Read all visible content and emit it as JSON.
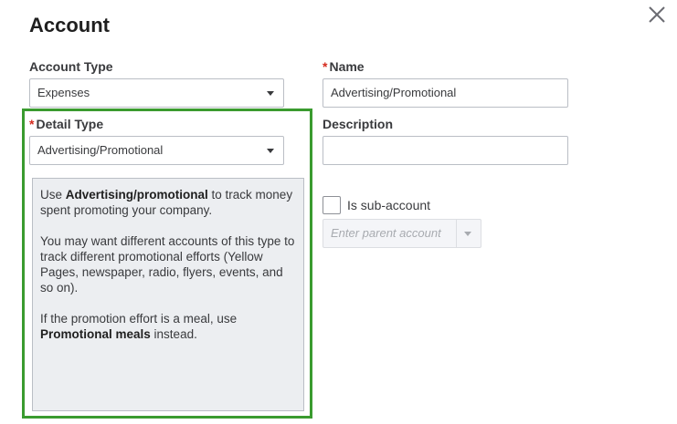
{
  "dialog": {
    "title": "Account",
    "close_icon": "close-icon"
  },
  "account_type": {
    "label": "Account Type",
    "value": "Expenses"
  },
  "detail_type": {
    "required_mark": "*",
    "label": "Detail Type",
    "value": "Advertising/Promotional",
    "highlight_color": "#3a9b2f"
  },
  "help": {
    "p1_prefix": "Use ",
    "p1_bold": "Advertising/promotional",
    "p1_suffix": " to track money spent promoting your company.",
    "p2": "You may want different accounts of this type to track different promotional efforts (Yellow Pages, newspaper, radio, flyers, events, and so on).",
    "p3_prefix": "If the promotion effort is a meal, use ",
    "p3_bold": "Promotional meals",
    "p3_suffix": " instead."
  },
  "name": {
    "required_mark": "*",
    "label": "Name",
    "value": "Advertising/Promotional"
  },
  "description": {
    "label": "Description",
    "value": ""
  },
  "sub_account": {
    "label": "Is sub-account",
    "checked": false,
    "parent_placeholder": "Enter parent account"
  },
  "colors": {
    "required": "#d52b1e",
    "help_bg": "#eceef1"
  }
}
